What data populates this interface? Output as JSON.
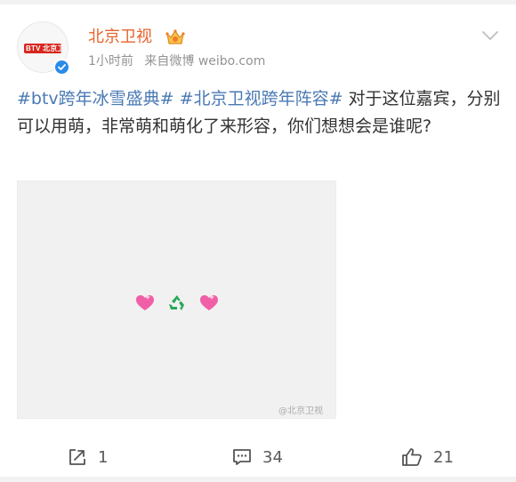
{
  "post": {
    "author": "北京卫视",
    "avatar_logo_text": "BTV 北京卫视",
    "time": "1小时前",
    "source": "来自微博 weibo.com",
    "hashtag1": "#btv跨年冰雪盛典#",
    "hashtag2": "#北京卫视跨年阵容#",
    "text": "对于这位嘉宾，分别可以用萌，非常萌和萌化了来形容，你们想想会是谁呢?",
    "image": {
      "emojis": [
        "sparkling-heart-icon",
        "recycle-icon",
        "sparkling-heart-icon"
      ],
      "watermark": "@北京卫视"
    }
  },
  "actions": {
    "repost_count": "1",
    "comment_count": "34",
    "like_count": "21"
  },
  "colors": {
    "author": "#e8632c",
    "hashtag": "#4a79b4",
    "verified": "#2a8be8",
    "meta": "#939393"
  }
}
